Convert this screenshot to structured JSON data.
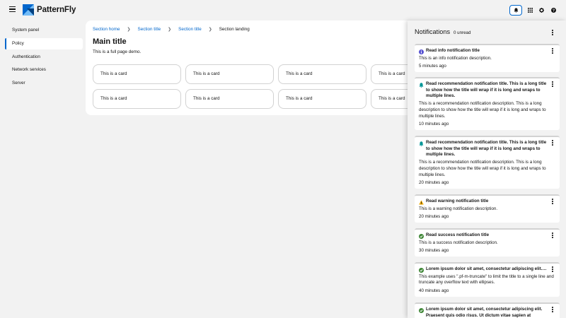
{
  "header": {
    "brand": "PatternFly",
    "icons": [
      "menu-icon",
      "bell-icon",
      "grid-icon",
      "gear-icon",
      "help-icon"
    ]
  },
  "sidebar": {
    "items": [
      {
        "label": "System panel",
        "active": false
      },
      {
        "label": "Policy",
        "active": true
      },
      {
        "label": "Authentication",
        "active": false
      },
      {
        "label": "Network services",
        "active": false
      },
      {
        "label": "Server",
        "active": false
      }
    ]
  },
  "main": {
    "breadcrumb": [
      "Section home",
      "Section title",
      "Section title",
      "Section landing"
    ],
    "title": "Main title",
    "description": "This is a full page demo.",
    "cards": [
      "This is a card",
      "This is a card",
      "This is a card",
      "This is a card",
      "This is a card",
      "This is a card",
      "This is a card",
      "This is a card"
    ]
  },
  "drawer": {
    "title": "Notifications",
    "unread": "0 unread",
    "notifications": [
      {
        "type": "info",
        "title": "Read info notification title",
        "description": "This is an info notification description.",
        "time": "5 minutes ago"
      },
      {
        "type": "recommendation",
        "title": "Read recommendation notification title. This is a long title to show how the title will wrap if it is long and wraps to multiple lines.",
        "description": "This is a recommendation notification description. This is a long description to show how the title will wrap if it is long and wraps to multiple lines.",
        "time": "10 minutes ago"
      },
      {
        "type": "recommendation",
        "title": "Read recommendation notification title. This is a long title to show how the title will wrap if it is long and wraps to multiple lines.",
        "description": "This is a recommendation notification description. This is a long description to show how the title will wrap if it is long and wraps to multiple lines.",
        "time": "20 minutes ago"
      },
      {
        "type": "warning",
        "title": "Read warning notification title",
        "description": "This is a warning notification description.",
        "time": "20 minutes ago"
      },
      {
        "type": "success",
        "title": "Read success notification title",
        "description": "This is a success notification description.",
        "time": "30 minutes ago"
      },
      {
        "type": "success",
        "title": "Lorem ipsum dolor sit amet, consectetur adipiscing elit. Praesent quis odio risus.",
        "description": "This example uses \".pf-m-truncate\" to limit the title to a single line and truncate any overflow text with ellipses.",
        "time": "40 minutes ago"
      },
      {
        "type": "success",
        "title": "Lorem ipsum dolor sit amet, consectetur adipiscing elit. Praesent quis odio risus. Ut dictum vitae sapien at posuere.",
        "description": "",
        "time": ""
      }
    ]
  },
  "colors": {
    "link": "#0066cc",
    "info": "#5752d1",
    "recommendation": "#009596",
    "warning": "#f0ab00",
    "success": "#3e8635"
  }
}
